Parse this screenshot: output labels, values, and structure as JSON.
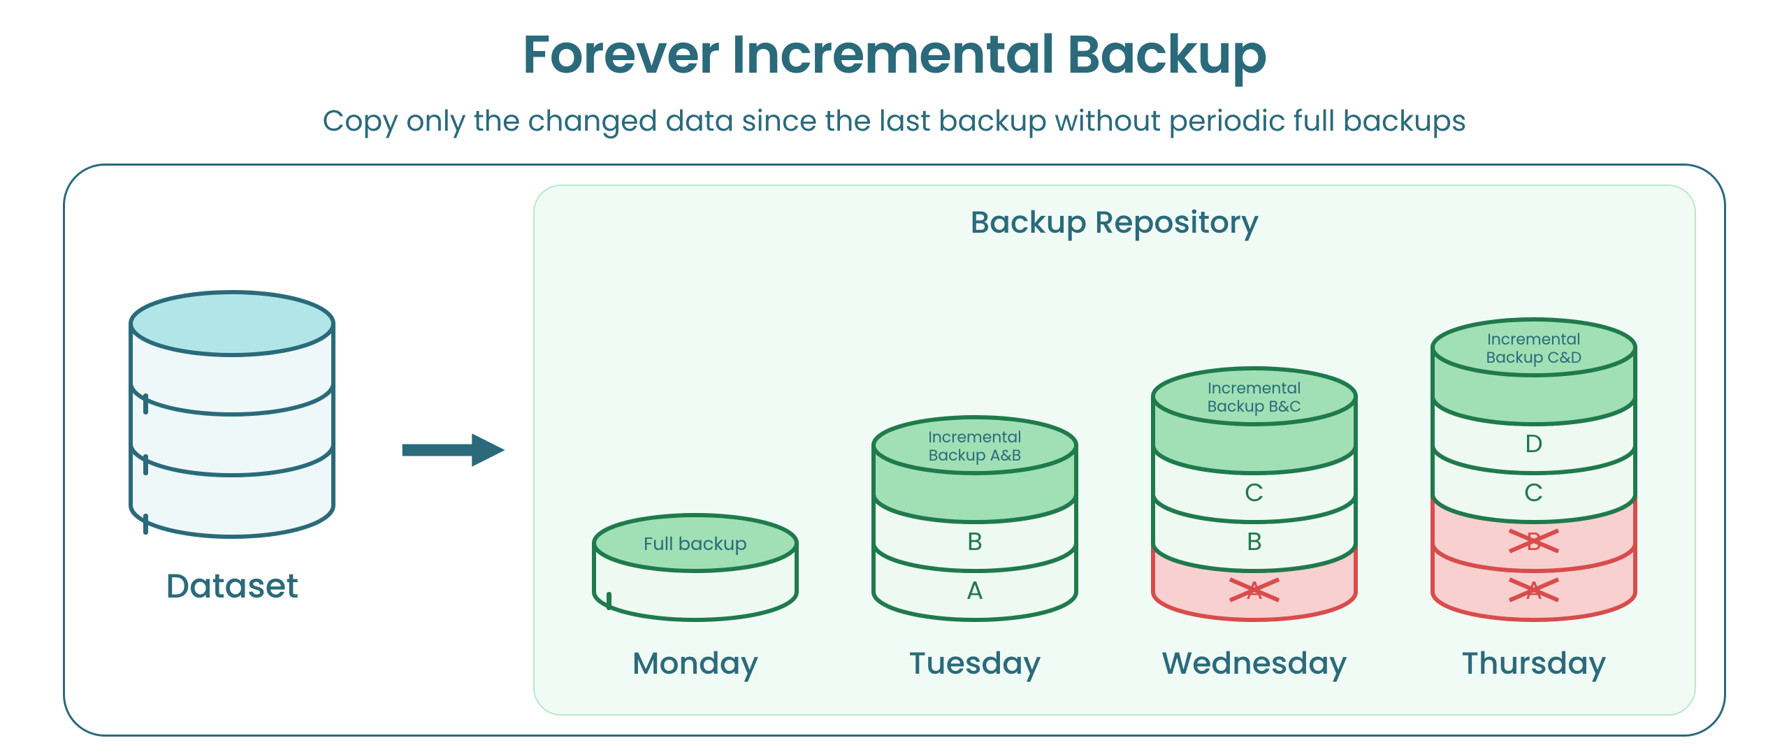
{
  "title": "Forever Incremental Backup",
  "subtitle": "Copy only the changed data since the last backup without periodic full backups",
  "dataset_label": "Dataset",
  "repo_title": "Backup Repository",
  "days": {
    "monday": {
      "label": "Monday",
      "top_label": "Full backup",
      "layers": []
    },
    "tuesday": {
      "label": "Tuesday",
      "top_label": "Incremental\nBackup A&B",
      "layers": [
        {
          "text": "B",
          "deleted": false
        },
        {
          "text": "A",
          "deleted": false
        }
      ]
    },
    "wednesday": {
      "label": "Wednesday",
      "top_label": "Incremental\nBackup B&C",
      "layers": [
        {
          "text": "C",
          "deleted": false
        },
        {
          "text": "B",
          "deleted": false
        },
        {
          "text": "A",
          "deleted": true
        }
      ]
    },
    "thursday": {
      "label": "Thursday",
      "top_label": "Incremental\nBackup C&D",
      "layers": [
        {
          "text": "D",
          "deleted": false
        },
        {
          "text": "C",
          "deleted": false
        },
        {
          "text": "B",
          "deleted": true
        },
        {
          "text": "A",
          "deleted": true
        }
      ]
    }
  },
  "colors": {
    "dark_teal": "#2a6a7b",
    "light_teal_fill": "#b2e5e8",
    "light_teal_body": "#eef8f9",
    "green_stroke": "#1f7a4c",
    "green_top": "#a0e0b4",
    "green_body": "#eef9f2",
    "red_stroke": "#d94c4c",
    "red_body": "#f8d0d0",
    "repo_bg": "#f0fbf5"
  }
}
